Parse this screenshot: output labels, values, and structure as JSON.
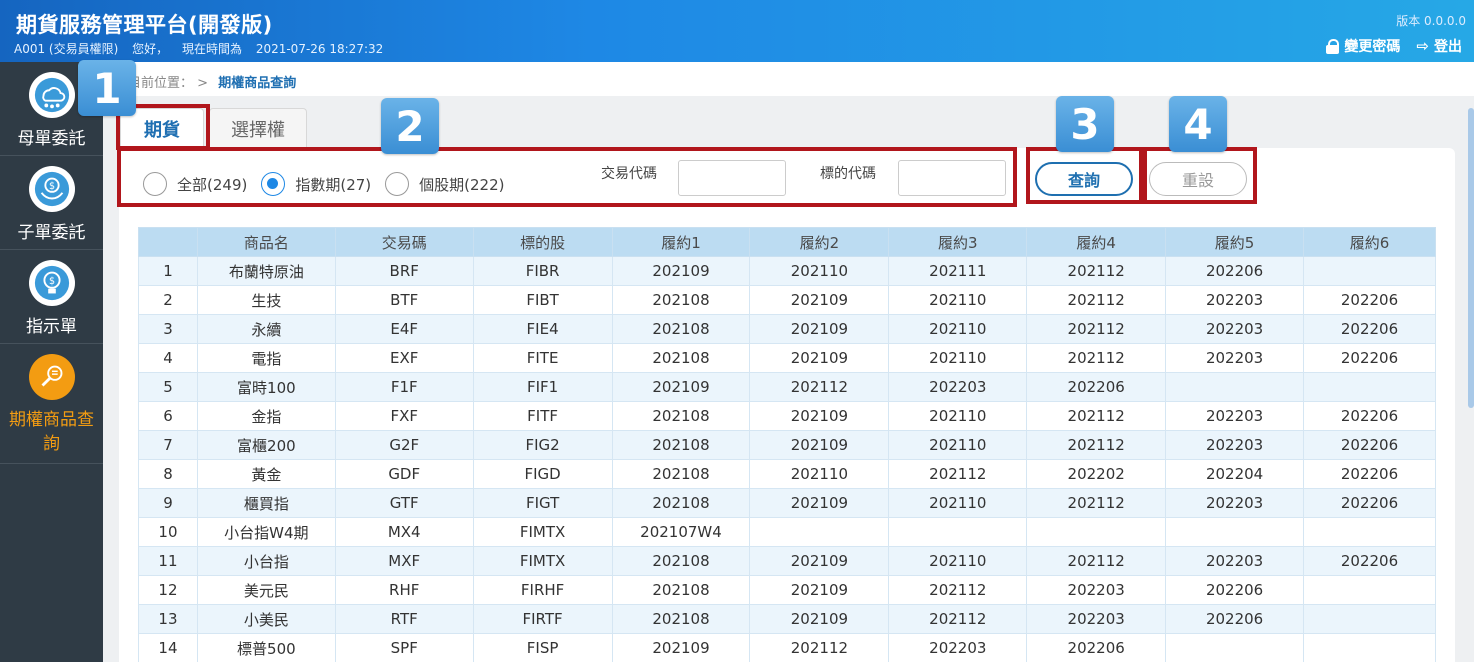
{
  "header": {
    "title": "期貨服務管理平台(開發版)",
    "account": "A001 (交易員權限)",
    "greeting": "您好，",
    "time_label": "現在時間為",
    "time_value": "2021-07-26 18:27:32",
    "version": "版本 0.0.0.0",
    "change_password": "變更密碼",
    "logout": "登出"
  },
  "sidebar": {
    "items": [
      {
        "label": "母單委託",
        "icon": "cloud-network-icon"
      },
      {
        "label": "子單委託",
        "icon": "money-hands-icon"
      },
      {
        "label": "指示單",
        "icon": "idea-bulb-icon"
      },
      {
        "label": "期權商品查詢",
        "icon": "search-list-icon",
        "active": true
      }
    ]
  },
  "breadcrumb": {
    "prefix": "目前位置：",
    "sep": ">",
    "current": "期權商品查詢"
  },
  "tabs": [
    {
      "label": "期貨",
      "active": true
    },
    {
      "label": "選擇權",
      "active": false
    }
  ],
  "filters": {
    "radios": [
      {
        "label": "全部(249)",
        "checked": false
      },
      {
        "label": "指數期(27)",
        "checked": true
      },
      {
        "label": "個股期(222)",
        "checked": false
      }
    ],
    "trade_code_label": "交易代碼",
    "trade_code_value": "",
    "underlying_code_label": "標的代碼",
    "underlying_code_value": ""
  },
  "buttons": {
    "query": "查詢",
    "reset": "重設"
  },
  "badges": [
    "1",
    "2",
    "3",
    "4"
  ],
  "colors": {
    "header": "#1e88e5",
    "sidebar": "#2f3b45",
    "active": "#f39c12",
    "highlight": "#b1161c",
    "badge": "#4a9edb"
  },
  "table": {
    "columns": [
      "",
      "商品名",
      "交易碼",
      "標的股",
      "履約1",
      "履約2",
      "履約3",
      "履約4",
      "履約5",
      "履約6"
    ],
    "rows": [
      [
        "1",
        "布蘭特原油",
        "BRF",
        "FIBR",
        "202109",
        "202110",
        "202111",
        "202112",
        "202206",
        ""
      ],
      [
        "2",
        "生技",
        "BTF",
        "FIBT",
        "202108",
        "202109",
        "202110",
        "202112",
        "202203",
        "202206"
      ],
      [
        "3",
        "永續",
        "E4F",
        "FIE4",
        "202108",
        "202109",
        "202110",
        "202112",
        "202203",
        "202206"
      ],
      [
        "4",
        "電指",
        "EXF",
        "FITE",
        "202108",
        "202109",
        "202110",
        "202112",
        "202203",
        "202206"
      ],
      [
        "5",
        "富時100",
        "F1F",
        "FIF1",
        "202109",
        "202112",
        "202203",
        "202206",
        "",
        ""
      ],
      [
        "6",
        "金指",
        "FXF",
        "FITF",
        "202108",
        "202109",
        "202110",
        "202112",
        "202203",
        "202206"
      ],
      [
        "7",
        "富櫃200",
        "G2F",
        "FIG2",
        "202108",
        "202109",
        "202110",
        "202112",
        "202203",
        "202206"
      ],
      [
        "8",
        "黃金",
        "GDF",
        "FIGD",
        "202108",
        "202110",
        "202112",
        "202202",
        "202204",
        "202206"
      ],
      [
        "9",
        "櫃買指",
        "GTF",
        "FIGT",
        "202108",
        "202109",
        "202110",
        "202112",
        "202203",
        "202206"
      ],
      [
        "10",
        "小台指W4期",
        "MX4",
        "FIMTX",
        "202107W4",
        "",
        "",
        "",
        "",
        ""
      ],
      [
        "11",
        "小台指",
        "MXF",
        "FIMTX",
        "202108",
        "202109",
        "202110",
        "202112",
        "202203",
        "202206"
      ],
      [
        "12",
        "美元民",
        "RHF",
        "FIRHF",
        "202108",
        "202109",
        "202112",
        "202203",
        "202206",
        ""
      ],
      [
        "13",
        "小美民",
        "RTF",
        "FIRTF",
        "202108",
        "202109",
        "202112",
        "202203",
        "202206",
        ""
      ],
      [
        "14",
        "標普500",
        "SPF",
        "FISP",
        "202109",
        "202112",
        "202203",
        "202206",
        "",
        ""
      ]
    ]
  }
}
